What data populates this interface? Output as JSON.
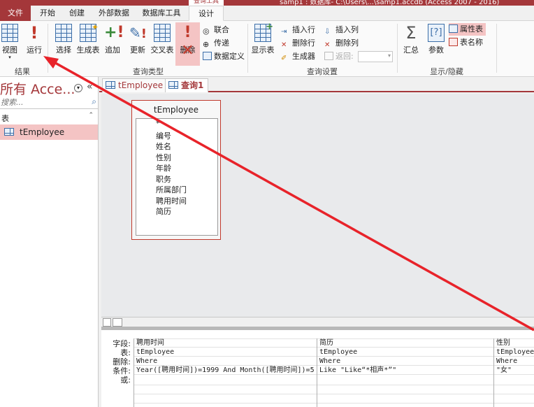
{
  "titlebar": {
    "context_tab": "查询工具",
    "title": "samp1 : 数据库- C:\\Users\\...\\samp1.accdb (Access 2007 - 2016)"
  },
  "tabs": [
    {
      "label": "文件"
    },
    {
      "label": "开始"
    },
    {
      "label": "创建"
    },
    {
      "label": "外部数据"
    },
    {
      "label": "数据库工具"
    },
    {
      "label": "设计"
    }
  ],
  "ribbon": {
    "results": {
      "view": "视图",
      "run": "运行",
      "group": "结果"
    },
    "query_type": {
      "select": "选择",
      "make_table": "生成表",
      "append": "追加",
      "update": "更新",
      "crosstab": "交叉表",
      "delete": "删除",
      "union": "联合",
      "pass_through": "传递",
      "data_definition": "数据定义",
      "group": "查询类型"
    },
    "query_setup": {
      "show_table": "显示表",
      "insert_rows": "插入行",
      "delete_rows": "删除行",
      "builder": "生成器",
      "insert_cols": "插入列",
      "delete_cols": "删除列",
      "return": "返回:",
      "return_value": "",
      "group": "查询设置"
    },
    "show_hide": {
      "totals": "汇总",
      "parameters": "参数",
      "property_sheet": "属性表",
      "table_names": "表名称",
      "group": "显示/隐藏"
    }
  },
  "navpane": {
    "title": "所有 Acce...",
    "search_placeholder": "搜索...",
    "section": "表",
    "items": [
      {
        "label": "tEmployee"
      }
    ]
  },
  "doctabs": [
    {
      "label": "tEmployee"
    },
    {
      "label": "查询1"
    }
  ],
  "tablebox": {
    "title": "tEmployee",
    "fields": [
      "*",
      "编号",
      "姓名",
      "性别",
      "年龄",
      "职务",
      "所属部门",
      "聘用时间",
      "简历"
    ]
  },
  "qbe": {
    "row_labels": [
      "字段:",
      "表:",
      "删除:",
      "条件:",
      "或:"
    ],
    "columns": [
      {
        "field": "聘用时间",
        "table": "tEmployee",
        "delete": "Where",
        "criteria": "Year([聘用时间])=1999 And Month([聘用时间])=5"
      },
      {
        "field": "简历",
        "table": "tEmployee",
        "delete": "Where",
        "criteria": "Like \"Like“*相声*”\""
      },
      {
        "field": "性别",
        "table": "tEmployee",
        "delete": "Where",
        "criteria": "\"女\""
      }
    ]
  },
  "colors": {
    "accent": "#a4373a",
    "highlight": "#f4c4c4",
    "arrow": "#e8232a"
  }
}
